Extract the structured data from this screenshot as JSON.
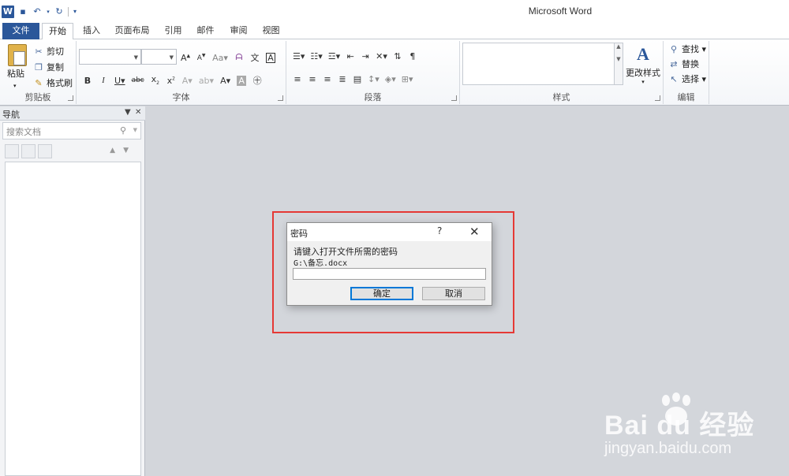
{
  "window": {
    "title": "Microsoft Word",
    "app_icon_letter": "W"
  },
  "quick_access": {
    "save_icon": "save-icon",
    "undo_icon": "undo-icon",
    "redo_icon": "redo-icon",
    "customize_icon": "customize-qat-icon"
  },
  "tabs": [
    {
      "label": "文件"
    },
    {
      "label": "开始"
    },
    {
      "label": "插入"
    },
    {
      "label": "页面布局"
    },
    {
      "label": "引用"
    },
    {
      "label": "邮件"
    },
    {
      "label": "审阅"
    },
    {
      "label": "视图"
    }
  ],
  "ribbon": {
    "clipboard": {
      "label": "剪贴板",
      "paste": "粘贴",
      "cut": "剪切",
      "copy": "复制",
      "format_painter": "格式刷"
    },
    "font": {
      "label": "字体"
    },
    "paragraph": {
      "label": "段落"
    },
    "styles": {
      "label": "样式",
      "change_styles": "更改样式"
    },
    "editing": {
      "label": "编辑",
      "find": "查找",
      "replace": "替换",
      "select": "选择"
    }
  },
  "nav_pane": {
    "title": "导航",
    "search_placeholder": "搜索文档"
  },
  "dialog": {
    "title": "密码",
    "help": "?",
    "close": "✕",
    "prompt": "请键入打开文件所需的密码",
    "path": "G:\\备忘.docx",
    "password_value": "",
    "ok_label": "确定",
    "cancel_label": "取消"
  },
  "watermark": {
    "logo": "Bai du 经验",
    "url": "jingyan.baidu.com"
  },
  "colors": {
    "accent": "#2b579a",
    "highlight_frame": "#e53935",
    "workspace": "#d3d6db"
  }
}
